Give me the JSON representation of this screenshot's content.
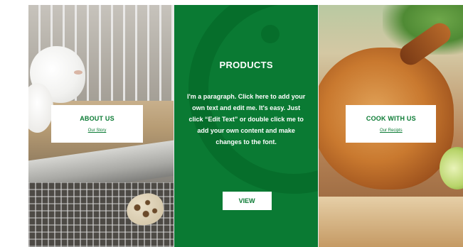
{
  "colors": {
    "brand_green": "#0a7a33",
    "card_white": "#ffffff"
  },
  "left_panel": {
    "image_icon": "quail-photo-icon",
    "card": {
      "title": "ABOUT US",
      "link": "Our Story"
    }
  },
  "middle_panel": {
    "watermark_icon": "logo-watermark-icon",
    "title": "PRODUCTS",
    "paragraph": "I'm a paragraph. Click here to add your own text and edit me. It's easy. Just click “Edit Text” or double click me to add your own content and make changes to the font.",
    "button_label": "VIEW"
  },
  "right_panel": {
    "image_icon": "roast-chicken-photo-icon",
    "card": {
      "title": "COOK WITH US",
      "link": "Our Recipts"
    }
  }
}
